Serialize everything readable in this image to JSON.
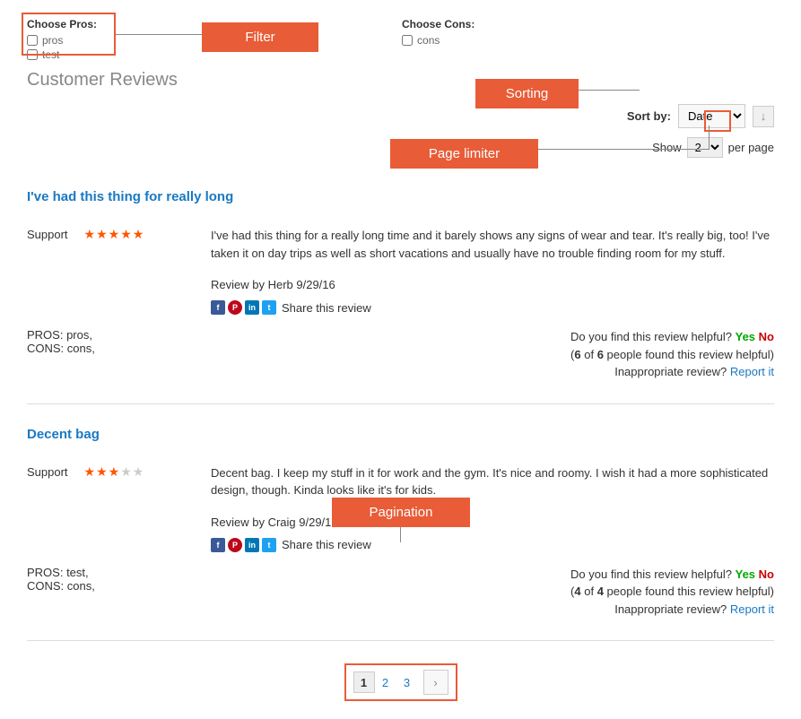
{
  "filters": {
    "pros_label": "Choose Pros:",
    "pros_items": [
      "pros",
      "test"
    ],
    "cons_label": "Choose Cons:",
    "cons_items": [
      "cons"
    ]
  },
  "section_title": "Customer Reviews",
  "callouts": {
    "filter": "Filter",
    "sorting": "Sorting",
    "page_limiter": "Page limiter",
    "pagination": "Pagination"
  },
  "sort": {
    "label": "Sort by:",
    "options": [
      "Date"
    ],
    "selected": "Date"
  },
  "limiter": {
    "show_label": "Show",
    "value": "2",
    "per_page_label": "per page"
  },
  "share_label": "Share this review",
  "helpful_question": "Do you find this review helpful?",
  "helpful_yes": "Yes",
  "helpful_no": "No",
  "inappropriate_label": "Inappropriate review?",
  "report_label": "Report it",
  "reviews": [
    {
      "title": "I've had this thing for really long",
      "rating_label": "Support",
      "rating": 5,
      "text": "I've had this thing for a really long time and it barely shows any signs of wear and tear. It's really big, too! I've taken it on day trips as well as short vacations and usually have no trouble finding room for my stuff.",
      "author": "Herb",
      "date": "9/29/16",
      "pros": "PROS: pros,",
      "cons": "CONS: cons,",
      "helpful_found": "6",
      "helpful_total": "6"
    },
    {
      "title": "Decent bag",
      "rating_label": "Support",
      "rating": 3,
      "text": "Decent bag. I keep my stuff in it for work and the gym. It's nice and roomy. I wish it had a more sophisticated design, though. Kinda looks like it's for kids.",
      "author": "Craig",
      "date": "9/29/16",
      "pros": "PROS: test,",
      "cons": "CONS: cons,",
      "helpful_found": "4",
      "helpful_total": "4"
    }
  ],
  "pagination": {
    "pages": [
      "1",
      "2",
      "3"
    ],
    "current": "1"
  }
}
